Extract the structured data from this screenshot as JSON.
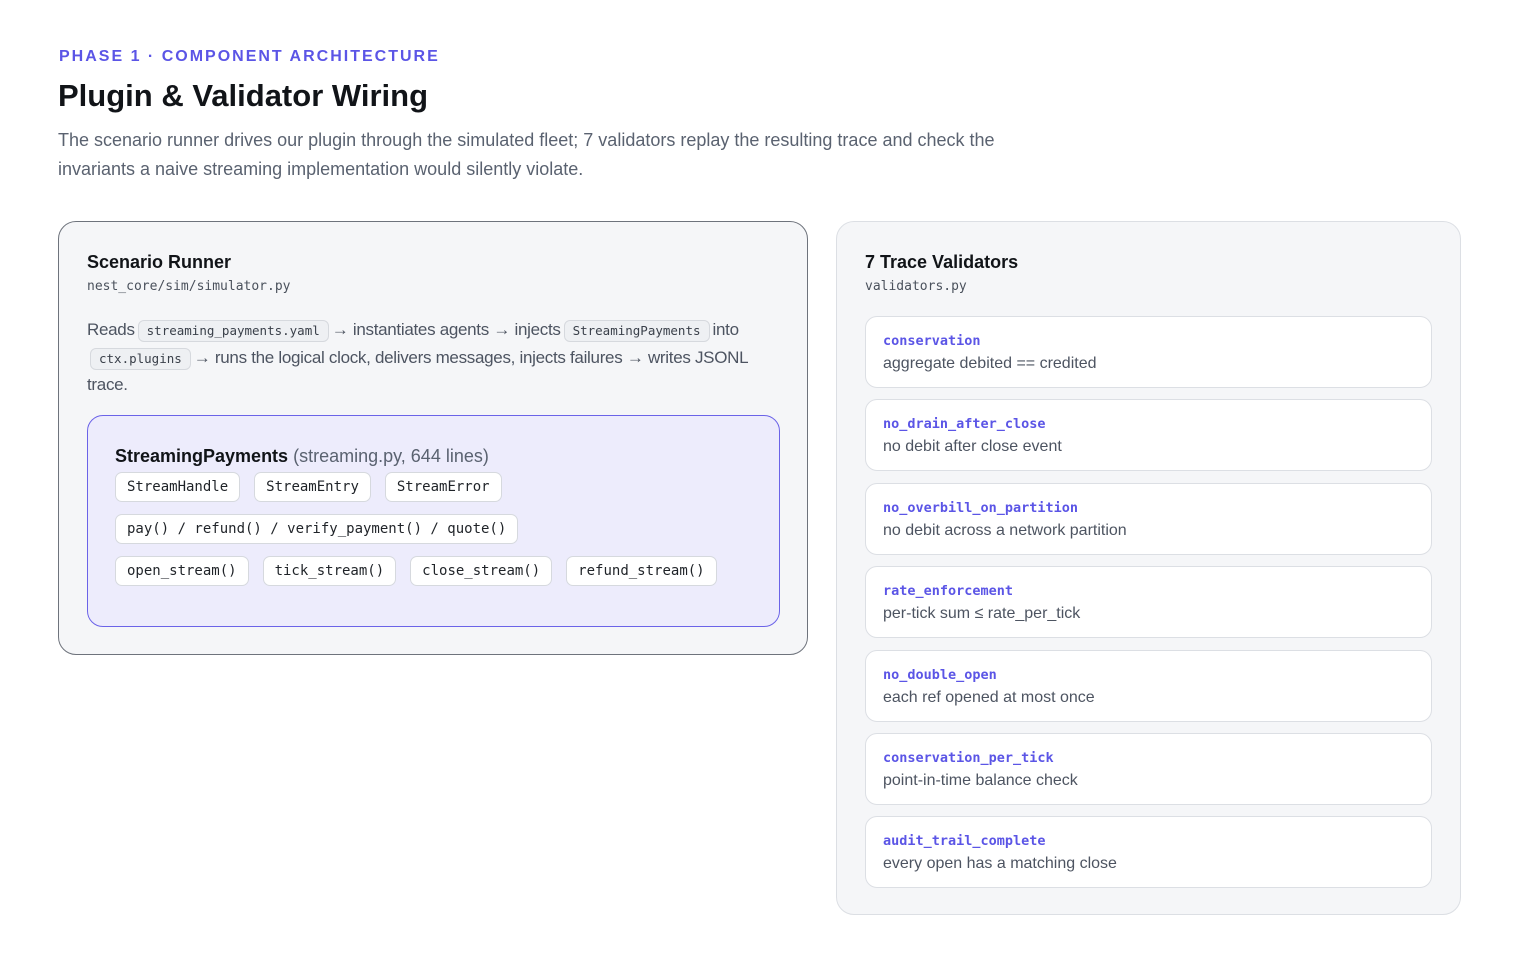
{
  "header": {
    "eyebrow": "PHASE 1 · COMPONENT ARCHITECTURE",
    "title": "Plugin & Validator Wiring",
    "subtitle": "The scenario runner drives our plugin through the simulated fleet; 7 validators replay the resulting trace and check the invariants a naive streaming implementation would silently violate."
  },
  "runner": {
    "title": "Scenario Runner",
    "path": "nest_core/sim/simulator.py",
    "desc": {
      "t1": "Reads",
      "c1": "streaming_payments.yaml",
      "t2": "→ instantiates agents → injects",
      "c2": "StreamingPayments",
      "t3": "into",
      "c3": "ctx.plugins",
      "t4": "→ runs the logical clock, delivers messages, injects failures → writes JSONL trace."
    },
    "plugin": {
      "name": "StreamingPayments",
      "meta": "(streaming.py, 644 lines)",
      "types": [
        "StreamHandle",
        "StreamEntry",
        "StreamError"
      ],
      "methods": "pay() / refund() / verify_payment() / quote()",
      "stream_ops": [
        "open_stream()",
        "tick_stream()",
        "close_stream()",
        "refund_stream()"
      ]
    }
  },
  "validators": {
    "title": "7 Trace Validators",
    "path": "validators.py",
    "items": [
      {
        "name": "conservation",
        "desc": "aggregate debited == credited"
      },
      {
        "name": "no_drain_after_close",
        "desc": "no debit after close event"
      },
      {
        "name": "no_overbill_on_partition",
        "desc": "no debit across a network partition"
      },
      {
        "name": "rate_enforcement",
        "desc": "per-tick sum ≤ rate_per_tick"
      },
      {
        "name": "no_double_open",
        "desc": "each ref opened at most once"
      },
      {
        "name": "conservation_per_tick",
        "desc": "point-in-time balance check"
      },
      {
        "name": "audit_trail_complete",
        "desc": "every open has a matching close"
      }
    ]
  },
  "colors": {
    "accent": "#5b55e6",
    "plugin_border": "#6b63e8",
    "plugin_bg": "#edecfc",
    "card_bg": "#f5f6f8"
  }
}
